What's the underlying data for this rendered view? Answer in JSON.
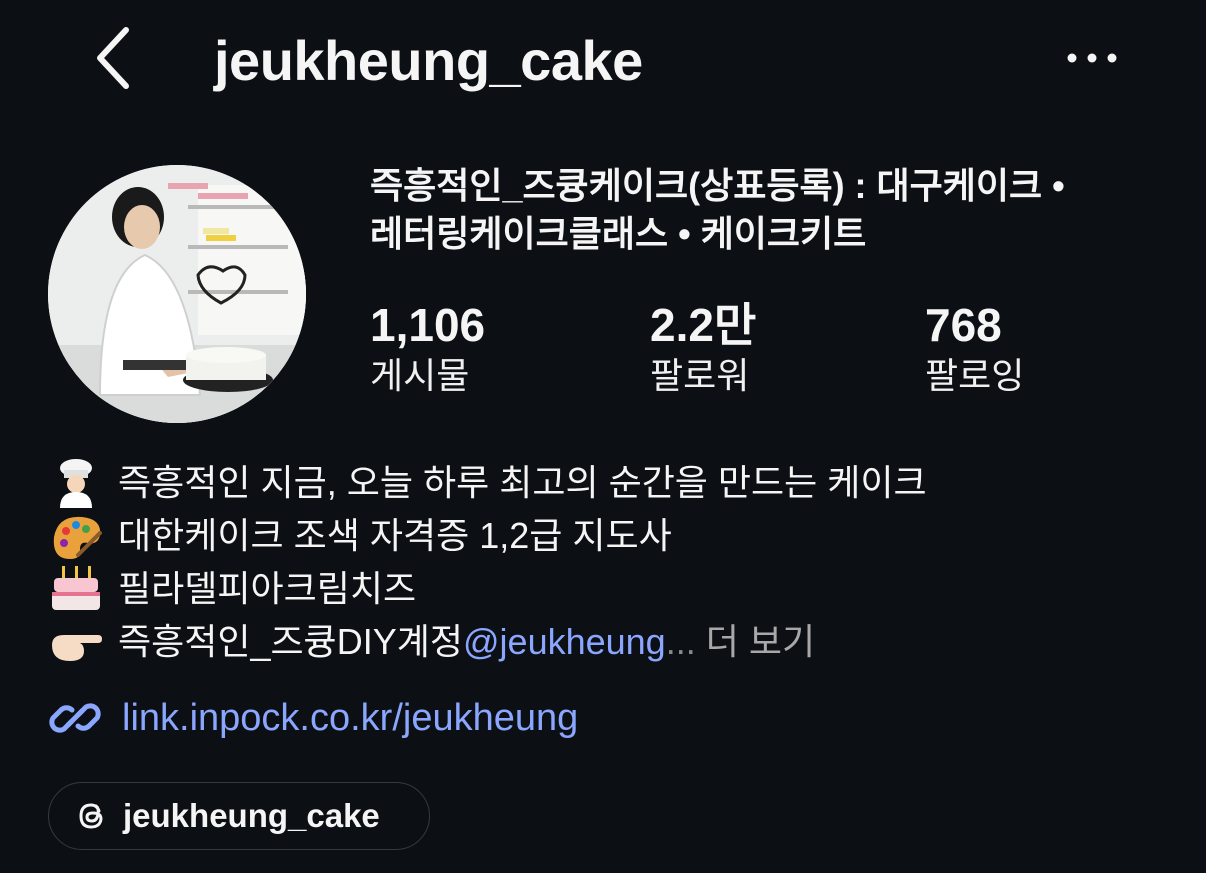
{
  "header": {
    "username": "jeukheung_cake",
    "back_icon": "chevron-left-icon",
    "more_icon": "more-horizontal-icon"
  },
  "profile": {
    "full_name_line1": "즉흥적인_즈큥케이크(상표등록) : 대구케이크 •",
    "full_name_line2": "레터링케이크클래스 • 케이크키트"
  },
  "stats": {
    "posts": {
      "value": "1,106",
      "label": "게시물"
    },
    "followers": {
      "value": "2.2만",
      "label": "팔로워"
    },
    "following": {
      "value": "768",
      "label": "팔로잉"
    }
  },
  "bio": {
    "line1": {
      "emoji": "chef-emoji",
      "text": "즉흥적인 지금, 오늘 하루 최고의 순간을 만드는 케이크"
    },
    "line2": {
      "emoji": "palette-emoji",
      "text": "대한케이크 조색 자격증 1,2급 지도사"
    },
    "line3": {
      "emoji": "birthday-cake-emoji",
      "text": "필라델피아크림치즈"
    },
    "line4": {
      "emoji": "pointing-right-emoji",
      "text": "즉흥적인_즈큥DIY계정 ",
      "mention": "@jeukheung",
      "ellipsis": "...",
      "more_label": "더 보기"
    }
  },
  "link": {
    "icon": "link-icon",
    "text": "link.inpock.co.kr/jeukheung"
  },
  "threads": {
    "icon": "threads-icon",
    "label": "jeukheung_cake"
  },
  "colors": {
    "background": "#0c1014",
    "link": "#8aa6ff",
    "muted": "#a8a8a8"
  }
}
